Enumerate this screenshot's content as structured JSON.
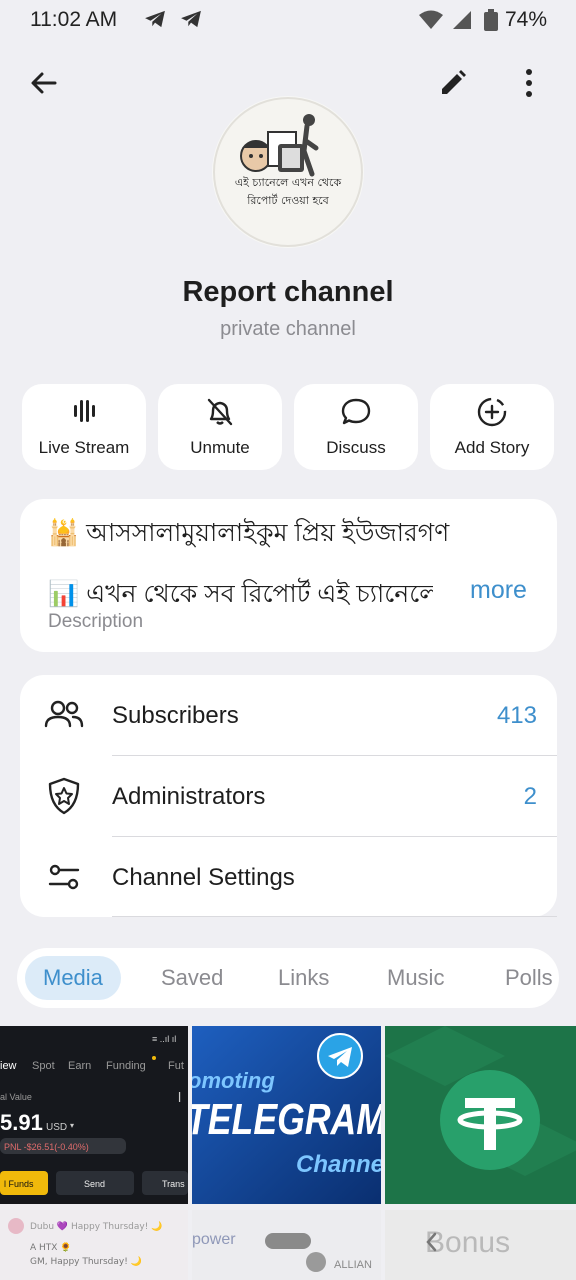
{
  "status": {
    "time": "11:02 AM",
    "battery": "74%"
  },
  "header": {
    "back_icon": "arrow-left-icon",
    "edit_icon": "pencil-icon",
    "more_icon": "vertical-dots-icon"
  },
  "avatar": {
    "text_line1": "এই চ্যানেলে এখন থেকে",
    "text_line2": "রিপোর্ট দেওয়া হবে"
  },
  "channel": {
    "title": "Report channel",
    "subtitle": "private channel"
  },
  "actions": [
    {
      "label": "Live Stream",
      "icon": "live-stream-icon"
    },
    {
      "label": "Unmute",
      "icon": "bell-off-icon"
    },
    {
      "label": "Discuss",
      "icon": "chat-bubble-icon"
    },
    {
      "label": "Add Story",
      "icon": "add-story-icon"
    }
  ],
  "description": {
    "line1": "🕌 আসসালামুয়ালাইকুম প্রিয় ইউজারগণ",
    "line2": "📊 এখন থেকে সব রিপোর্ট এই চ্যানেলে দেওয়া হবে",
    "more": "more",
    "label": "Description"
  },
  "info": [
    {
      "label": "Subscribers",
      "value": "413",
      "icon": "users-icon"
    },
    {
      "label": "Administrators",
      "value": "2",
      "icon": "shield-star-icon"
    },
    {
      "label": "Channel Settings",
      "value": "",
      "icon": "sliders-icon"
    }
  ],
  "tabs": [
    "Media",
    "Saved",
    "Links",
    "Music",
    "Polls"
  ],
  "media": {
    "item1": {
      "nav": [
        "iew",
        "Spot",
        "Earn",
        "Funding",
        "Fut"
      ],
      "label": "al Value",
      "amount": "5.91",
      "currency": "USD",
      "pnl": "PNL -$26.51(-0.40%)",
      "btns": [
        "l Funds",
        "Send",
        "Trans"
      ]
    },
    "item2": {
      "line1": "omoting",
      "line2": "TELEGRAM",
      "line3": "Channe"
    },
    "item4": {
      "line1": "Dubu 💜 Happy Thursday! 🌙",
      "line2": "A HTX 🌻",
      "line3": "GM, Happy Thursday! 🌙"
    },
    "item5": {
      "text": "power"
    },
    "item6": {
      "text": "ALLIAN"
    },
    "item7": {
      "text": "Bonus"
    }
  },
  "colors": {
    "accent": "#3e8fcc",
    "background": "#efeff3",
    "card": "#ffffff"
  }
}
